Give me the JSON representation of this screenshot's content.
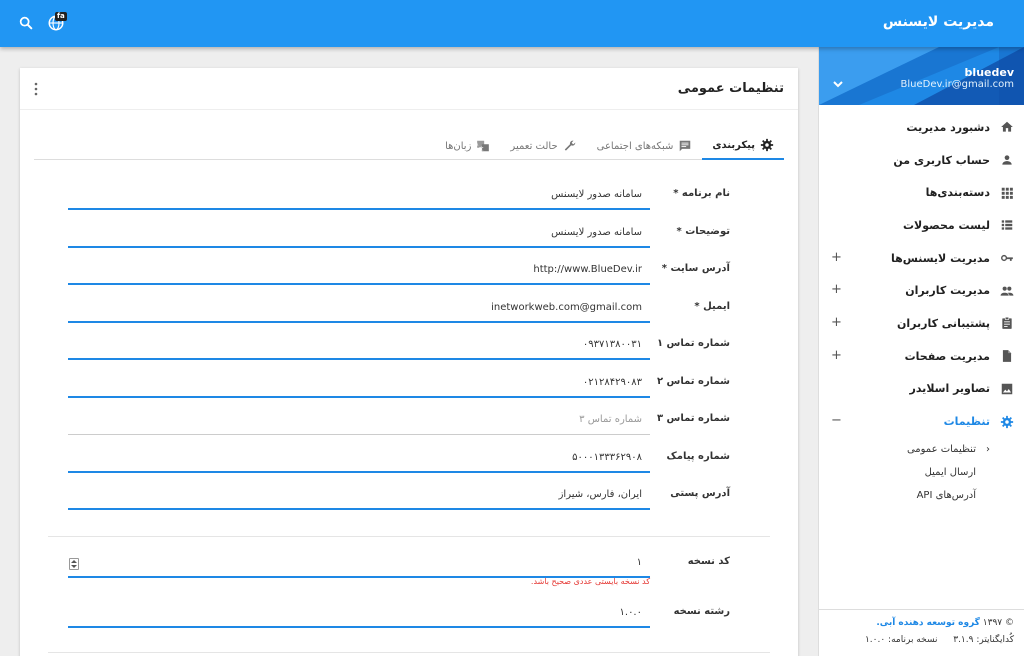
{
  "header": {
    "app_title": "مدیریت لایسنس",
    "lang_badge": "fa"
  },
  "profile": {
    "name": "bluedev",
    "email": "BlueDev.ir@gmail.com"
  },
  "sidebar": {
    "items": [
      {
        "label": "دشبورد مدیریت",
        "icon": "home-icon",
        "expand": ""
      },
      {
        "label": "حساب کاربری من",
        "icon": "person-icon",
        "expand": ""
      },
      {
        "label": "دسته‌بندی‌ها",
        "icon": "grid-icon",
        "expand": ""
      },
      {
        "label": "لیست محصولات",
        "icon": "list-icon",
        "expand": ""
      },
      {
        "label": "مدیریت لایسنس‌ها",
        "icon": "key-icon",
        "expand": "+"
      },
      {
        "label": "مدیریت کاربران",
        "icon": "group-icon",
        "expand": "+"
      },
      {
        "label": "پشتیبانی کاربران",
        "icon": "clipboard-icon",
        "expand": "+"
      },
      {
        "label": "مدیریت صفحات",
        "icon": "file-icon",
        "expand": "+"
      },
      {
        "label": "تصاویر اسلایدر",
        "icon": "image-icon",
        "expand": ""
      },
      {
        "label": "تنظیمات",
        "icon": "gear-icon",
        "expand": "−"
      }
    ],
    "subitems": [
      {
        "label": "تنظیمات عمومی"
      },
      {
        "label": "ارسال ایمیل"
      },
      {
        "label": "آدرس‌های API"
      }
    ],
    "accent": "#1e88e5"
  },
  "footer": {
    "copyright_prefix": "© ۱۳۹۷",
    "company": "گروه توسعه دهنده آبی.",
    "codeigniter": "کُدایگنایتر: ۳.۱.۹",
    "app_version": "نسخه برنامه: ۱.۰.۰"
  },
  "card": {
    "title": "تنظیمات عمومی"
  },
  "tabs": [
    {
      "label": "پیکربندی",
      "icon": "gear-icon"
    },
    {
      "label": "شبکه‌های اجتماعی",
      "icon": "chat-icon"
    },
    {
      "label": "حالت تعمیر",
      "icon": "wrench-icon"
    },
    {
      "label": "زبان‌ها",
      "icon": "translate-icon"
    }
  ],
  "form": {
    "app_name": {
      "label": "نام برنامه *",
      "value": "سامانه صدور لایسنس"
    },
    "description": {
      "label": "توضیحات *",
      "value": "سامانه صدور لایسنس"
    },
    "site_url": {
      "label": "آدرس سایت *",
      "value": "http://www.BlueDev.ir"
    },
    "email": {
      "label": "ایمیل *",
      "value": "inetworkweb.com@gmail.com"
    },
    "phone1": {
      "label": "شماره تماس ۱",
      "value": "۰۹۳۷۱۳۸۰۰۳۱"
    },
    "phone2": {
      "label": "شماره تماس ۲",
      "value": "۰۲۱۲۸۴۲۹۰۸۳"
    },
    "phone3": {
      "label": "شماره تماس ۳",
      "value": "",
      "placeholder": "شماره تماس ۳"
    },
    "sms": {
      "label": "شماره پیامک",
      "value": "۵۰۰۰۱۳۳۳۶۲۹۰۸"
    },
    "address": {
      "label": "آدرس پستی",
      "value": "ایران، فارس، شیراز"
    },
    "version_code": {
      "label": "کد نسخه",
      "value": "۱",
      "error": "کد نسخه بایستی عددی صحیح باشد."
    },
    "version_string": {
      "label": "رشته نسخه",
      "value": "۱.۰.۰"
    }
  }
}
